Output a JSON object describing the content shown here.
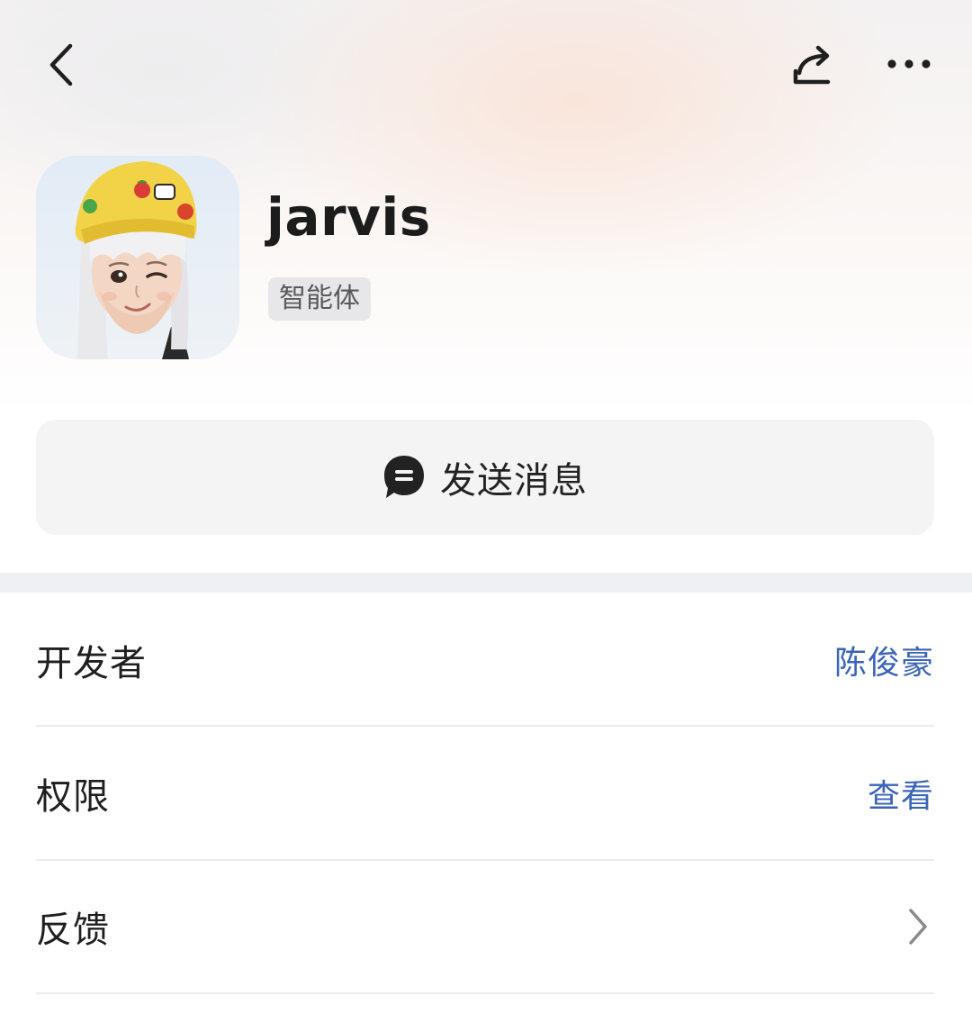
{
  "header": {
    "back_icon": "chevron-left-icon",
    "share_icon": "share-icon",
    "more_icon": "more-horizontal-icon"
  },
  "profile": {
    "name": "jarvis",
    "badge": "智能体",
    "avatar_icon": "cartoon-avatar"
  },
  "actions": {
    "send_message_label": "发送消息",
    "send_message_icon": "chat-bubble-icon"
  },
  "info_rows": [
    {
      "label": "开发者",
      "value": "陈俊豪"
    },
    {
      "label": "权限",
      "value": "查看"
    },
    {
      "label": "反馈",
      "value": ""
    }
  ],
  "colors": {
    "link": "#3a64b8",
    "badge_bg": "#e7e7e9",
    "button_bg": "#f4f4f5"
  }
}
